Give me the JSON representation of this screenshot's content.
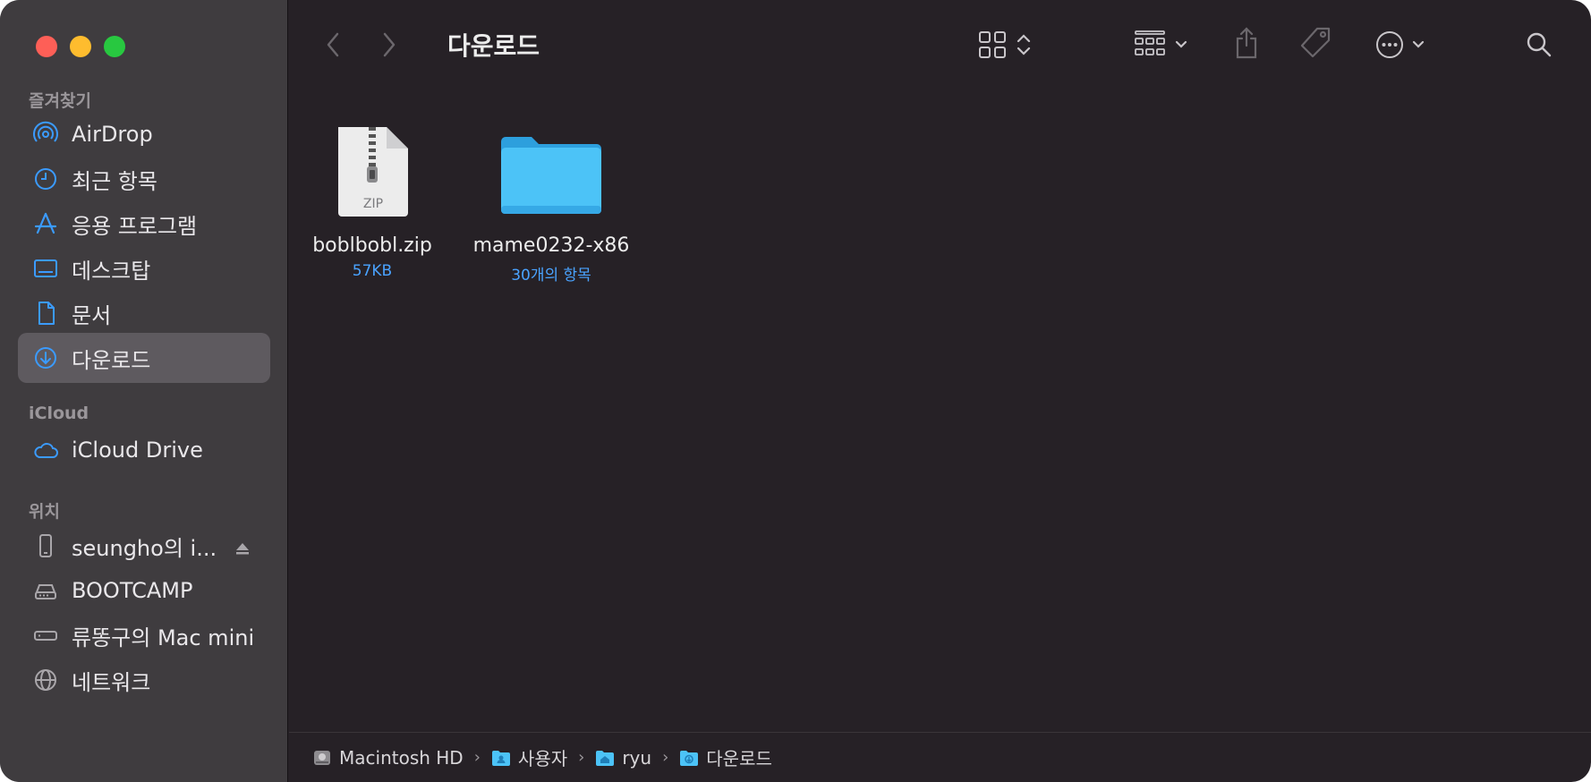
{
  "window": {
    "title": "다운로드"
  },
  "sidebar": {
    "favorites_title": "즐겨찾기",
    "favorites": [
      {
        "label": "AirDrop",
        "icon": "airdrop-icon"
      },
      {
        "label": "최근 항목",
        "icon": "clock-icon"
      },
      {
        "label": "응용 프로그램",
        "icon": "applications-icon"
      },
      {
        "label": "데스크탑",
        "icon": "desktop-icon"
      },
      {
        "label": "문서",
        "icon": "document-icon"
      },
      {
        "label": "다운로드",
        "icon": "download-icon",
        "selected": true
      }
    ],
    "icloud_title": "iCloud",
    "icloud": [
      {
        "label": "iCloud Drive",
        "icon": "cloud-icon"
      }
    ],
    "locations_title": "위치",
    "locations": [
      {
        "label": "seungho의 i...",
        "icon": "iphone-icon",
        "eject": true
      },
      {
        "label": "BOOTCAMP",
        "icon": "drive-icon"
      },
      {
        "label": "류똥구의 Mac mini",
        "icon": "mac-mini-icon"
      },
      {
        "label": "네트워크",
        "icon": "network-icon"
      }
    ]
  },
  "files": [
    {
      "name": "boblbobl.zip",
      "sub": "57KB",
      "type": "zip",
      "badge": "ZIP"
    },
    {
      "name": "mame0232-x86",
      "sub": "30개의 항목",
      "type": "folder"
    }
  ],
  "pathbar": [
    {
      "label": "Macintosh HD",
      "icon": "hard-disk-icon"
    },
    {
      "label": "사용자",
      "icon": "users-folder-icon"
    },
    {
      "label": "ryu",
      "icon": "home-folder-icon"
    },
    {
      "label": "다운로드",
      "icon": "downloads-folder-icon"
    }
  ],
  "colors": {
    "accent": "#4aa3ff",
    "folder": "#4cc3f7",
    "sidebar_bg": "#3f3c3f",
    "content_bg": "#262126"
  }
}
